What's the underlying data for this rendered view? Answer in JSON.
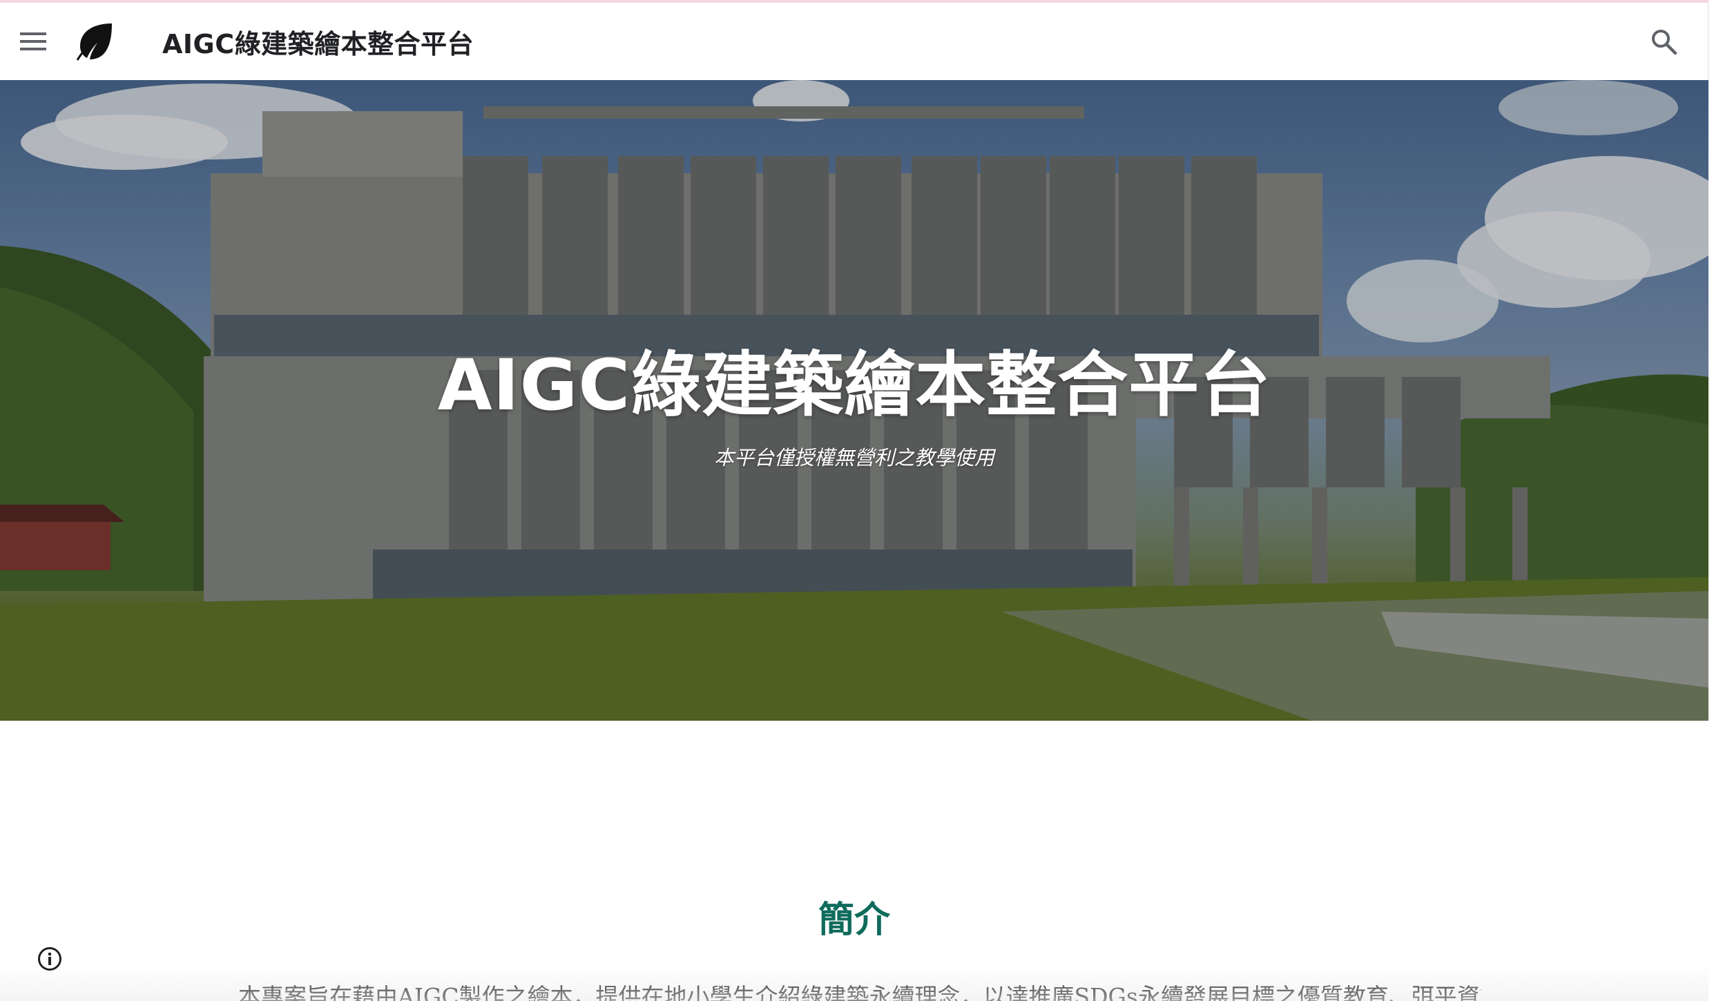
{
  "header": {
    "site_title": "AIGC綠建築繪本整合平台",
    "menu_icon": "hamburger-menu-icon",
    "logo_icon": "leaf-icon",
    "search_icon": "search-icon"
  },
  "hero": {
    "title": "AIGC綠建築繪本整合平台",
    "subtitle": "本平台僅授權無營利之教學使用"
  },
  "intro": {
    "heading": "簡介",
    "text": "本專案旨在藉由AIGC製作之繪本，提供在地小學生介紹綠建築永續理念，以達推廣SDGs永續發展目標之優質教育、弭平資訊不平等，促進"
  },
  "footer": {
    "info_icon": "info-icon"
  },
  "colors": {
    "heading": "#0f6b5c",
    "top_accent": "#f3d6e2"
  }
}
